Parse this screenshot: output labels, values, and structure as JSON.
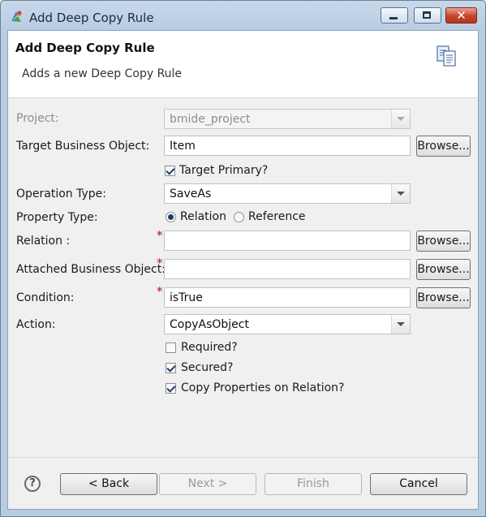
{
  "window": {
    "title": "Add Deep Copy Rule",
    "controls": {
      "minimize": "minimize-icon",
      "maximize": "maximize-icon",
      "close": "close-icon"
    }
  },
  "header": {
    "title": "Add Deep Copy Rule",
    "description": "Adds a new Deep Copy Rule",
    "icon": "copy-document-icon"
  },
  "form": {
    "project": {
      "label": "Project:",
      "value": "bmide_project"
    },
    "target_bo": {
      "label": "Target Business Object:",
      "value": "Item",
      "browse": "Browse..."
    },
    "target_primary": {
      "label": "Target Primary?",
      "checked": true
    },
    "operation_type": {
      "label": "Operation Type:",
      "value": "SaveAs"
    },
    "property_type": {
      "label": "Property Type:",
      "options": [
        "Relation",
        "Reference"
      ],
      "selected": "Relation"
    },
    "relation": {
      "label": "Relation :",
      "value": "",
      "required_mark": "*",
      "browse": "Browse..."
    },
    "attached_bo": {
      "label": "Attached Business Object:",
      "value": "",
      "required_mark": "*",
      "browse": "Browse..."
    },
    "condition": {
      "label": "Condition:",
      "value": "isTrue",
      "required_mark": "*",
      "browse": "Browse..."
    },
    "action": {
      "label": "Action:",
      "value": "CopyAsObject"
    },
    "required": {
      "label": "Required?",
      "checked": false
    },
    "secured": {
      "label": "Secured?",
      "checked": true
    },
    "copy_props": {
      "label": "Copy Properties on Relation?",
      "checked": true
    }
  },
  "footer": {
    "help_icon": "?",
    "back": "< Back",
    "next": "Next >",
    "finish": "Finish",
    "cancel": "Cancel"
  },
  "colors": {
    "required": "#b01818",
    "title_bar": "#b7cbe1",
    "close": "#c7432b"
  }
}
